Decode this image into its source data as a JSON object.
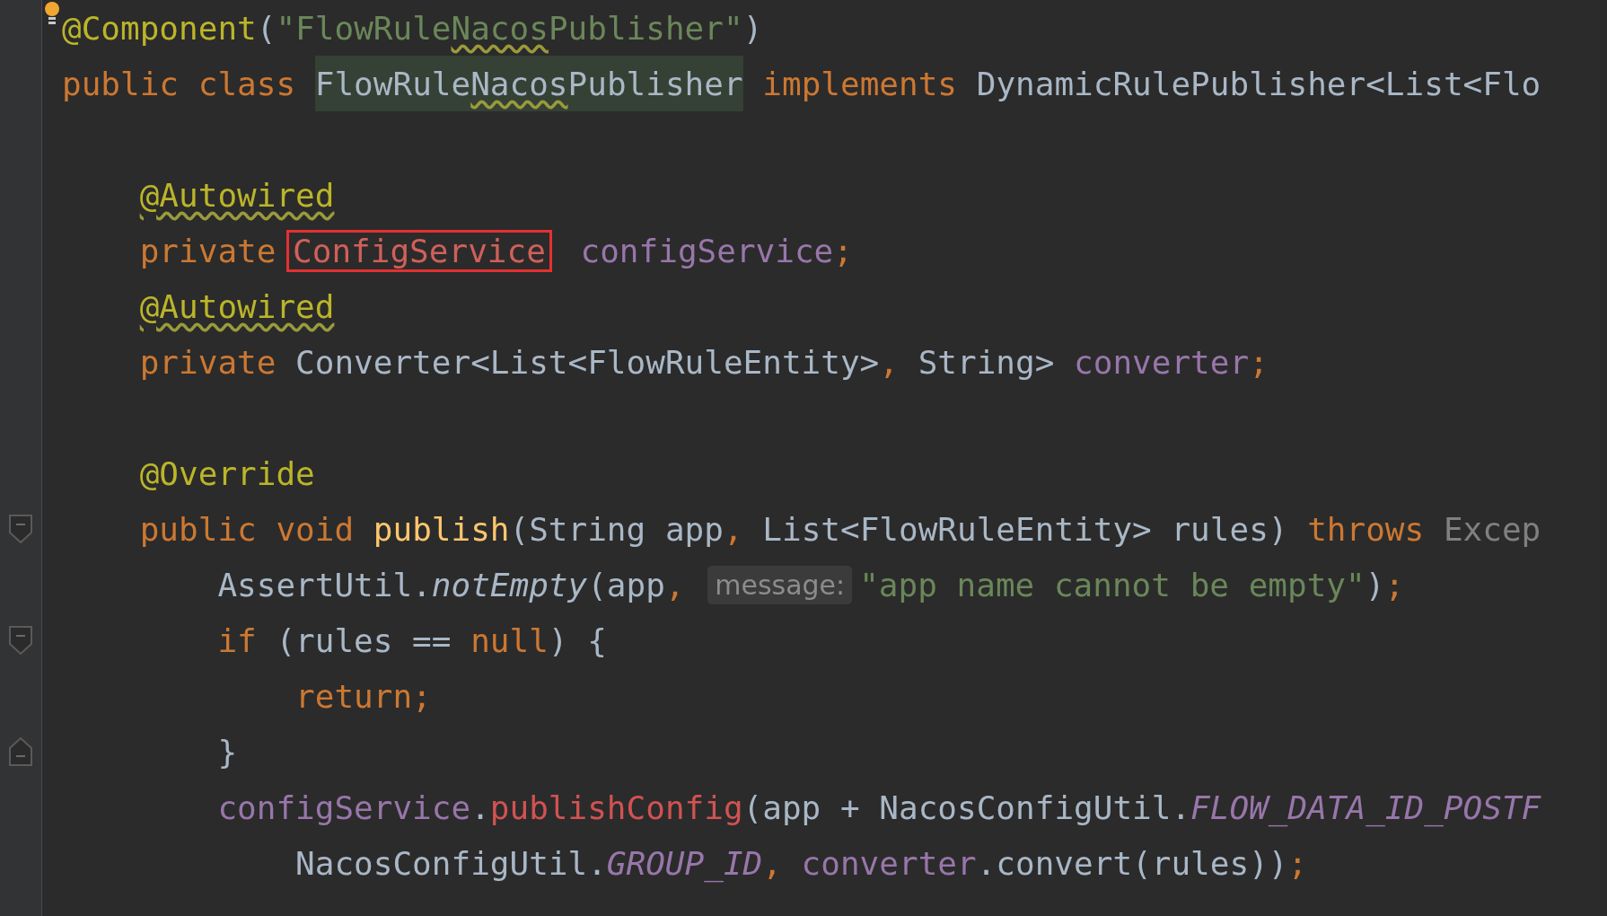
{
  "editor": {
    "lines": [
      {
        "kind": "code",
        "intention_bulb": true,
        "tokens": [
          {
            "text": "@Component",
            "kind": "annotation"
          },
          {
            "text": "(",
            "kind": "plain"
          },
          {
            "text": "\"FlowRule",
            "kind": "string"
          },
          {
            "text": "Nacos",
            "kind": "string",
            "warning": true
          },
          {
            "text": "Publisher\"",
            "kind": "string"
          },
          {
            "text": ")",
            "kind": "plain"
          }
        ]
      },
      {
        "kind": "code",
        "tokens": [
          {
            "text": "public class ",
            "kind": "keyword"
          },
          {
            "text": "FlowRule",
            "kind": "plain",
            "highlighted": true
          },
          {
            "text": "Nacos",
            "kind": "plain",
            "highlighted": true,
            "warning": true
          },
          {
            "text": "Publisher",
            "kind": "plain",
            "highlighted": true
          },
          {
            "text": " implements ",
            "kind": "keyword"
          },
          {
            "text": "DynamicRulePublisher<List<Flo",
            "kind": "plain"
          }
        ],
        "children": [
          {
            "kind": "blank"
          },
          {
            "kind": "code",
            "tokens": [
              {
                "text": "@Autowired",
                "kind": "annotation",
                "warning": true
              }
            ]
          },
          {
            "kind": "code",
            "tokens": [
              {
                "text": "private ",
                "kind": "keyword"
              },
              {
                "text": "ConfigService",
                "kind": "error",
                "boxed": true
              },
              {
                "text": " configService",
                "kind": "field"
              },
              {
                "text": ";",
                "kind": "keyword"
              }
            ]
          },
          {
            "kind": "code",
            "tokens": [
              {
                "text": "@Autowired",
                "kind": "annotation",
                "warning": true
              }
            ]
          },
          {
            "kind": "code",
            "tokens": [
              {
                "text": "private ",
                "kind": "keyword"
              },
              {
                "text": "Converter<List<FlowRuleEntity>",
                "kind": "plain"
              },
              {
                "text": ", ",
                "kind": "keyword"
              },
              {
                "text": "String> ",
                "kind": "plain"
              },
              {
                "text": "converter",
                "kind": "field"
              },
              {
                "text": ";",
                "kind": "keyword"
              }
            ]
          },
          {
            "kind": "blank"
          },
          {
            "kind": "code",
            "tokens": [
              {
                "text": "@Override",
                "kind": "annotation"
              }
            ]
          },
          {
            "kind": "code",
            "fold_start": true,
            "tokens": [
              {
                "text": "public void ",
                "kind": "keyword"
              },
              {
                "text": "publish",
                "kind": "method"
              },
              {
                "text": "(String app",
                "kind": "plain"
              },
              {
                "text": ", ",
                "kind": "keyword"
              },
              {
                "text": "List<FlowRuleEntity> rules) ",
                "kind": "plain"
              },
              {
                "text": "throws ",
                "kind": "keyword"
              },
              {
                "text": "Excep",
                "kind": "dim"
              }
            ],
            "children": [
              {
                "kind": "code",
                "tokens": [
                  {
                    "text": "AssertUtil.",
                    "kind": "plain"
                  },
                  {
                    "text": "notEmpty",
                    "kind": "italic"
                  },
                  {
                    "text": "(app",
                    "kind": "plain"
                  },
                  {
                    "text": ", ",
                    "kind": "keyword"
                  },
                  {
                    "text": "message:",
                    "kind": "hint"
                  },
                  {
                    "text": "\"app name cannot be empty\"",
                    "kind": "string"
                  },
                  {
                    "text": ")",
                    "kind": "plain"
                  },
                  {
                    "text": ";",
                    "kind": "keyword"
                  }
                ]
              },
              {
                "kind": "code",
                "fold_start": true,
                "tokens": [
                  {
                    "text": "if ",
                    "kind": "keyword"
                  },
                  {
                    "text": "(rules == ",
                    "kind": "plain"
                  },
                  {
                    "text": "null",
                    "kind": "keyword"
                  },
                  {
                    "text": ") {",
                    "kind": "plain"
                  }
                ],
                "children": [
                  {
                    "kind": "code",
                    "tokens": [
                      {
                        "text": "return;",
                        "kind": "keyword"
                      }
                    ]
                  }
                ]
              },
              {
                "kind": "code",
                "fold_end": true,
                "tokens": [
                  {
                    "text": "}",
                    "kind": "plain"
                  }
                ]
              },
              {
                "kind": "code",
                "tokens": [
                  {
                    "text": "configService",
                    "kind": "field"
                  },
                  {
                    "text": ".",
                    "kind": "plain"
                  },
                  {
                    "text": "publishConfig",
                    "kind": "call"
                  },
                  {
                    "text": "(app + NacosConfigUtil.",
                    "kind": "plain"
                  },
                  {
                    "text": "FLOW_DATA_ID_POSTF",
                    "kind": "static"
                  }
                ],
                "children": [
                  {
                    "kind": "code",
                    "tokens": [
                      {
                        "text": "NacosConfigUtil.",
                        "kind": "plain"
                      },
                      {
                        "text": "GROUP_ID",
                        "kind": "static"
                      },
                      {
                        "text": ", ",
                        "kind": "keyword"
                      },
                      {
                        "text": "converter",
                        "kind": "field"
                      },
                      {
                        "text": ".convert(rules))",
                        "kind": "plain"
                      },
                      {
                        "text": ";",
                        "kind": "keyword"
                      }
                    ]
                  }
                ]
              }
            ]
          }
        ]
      }
    ]
  }
}
